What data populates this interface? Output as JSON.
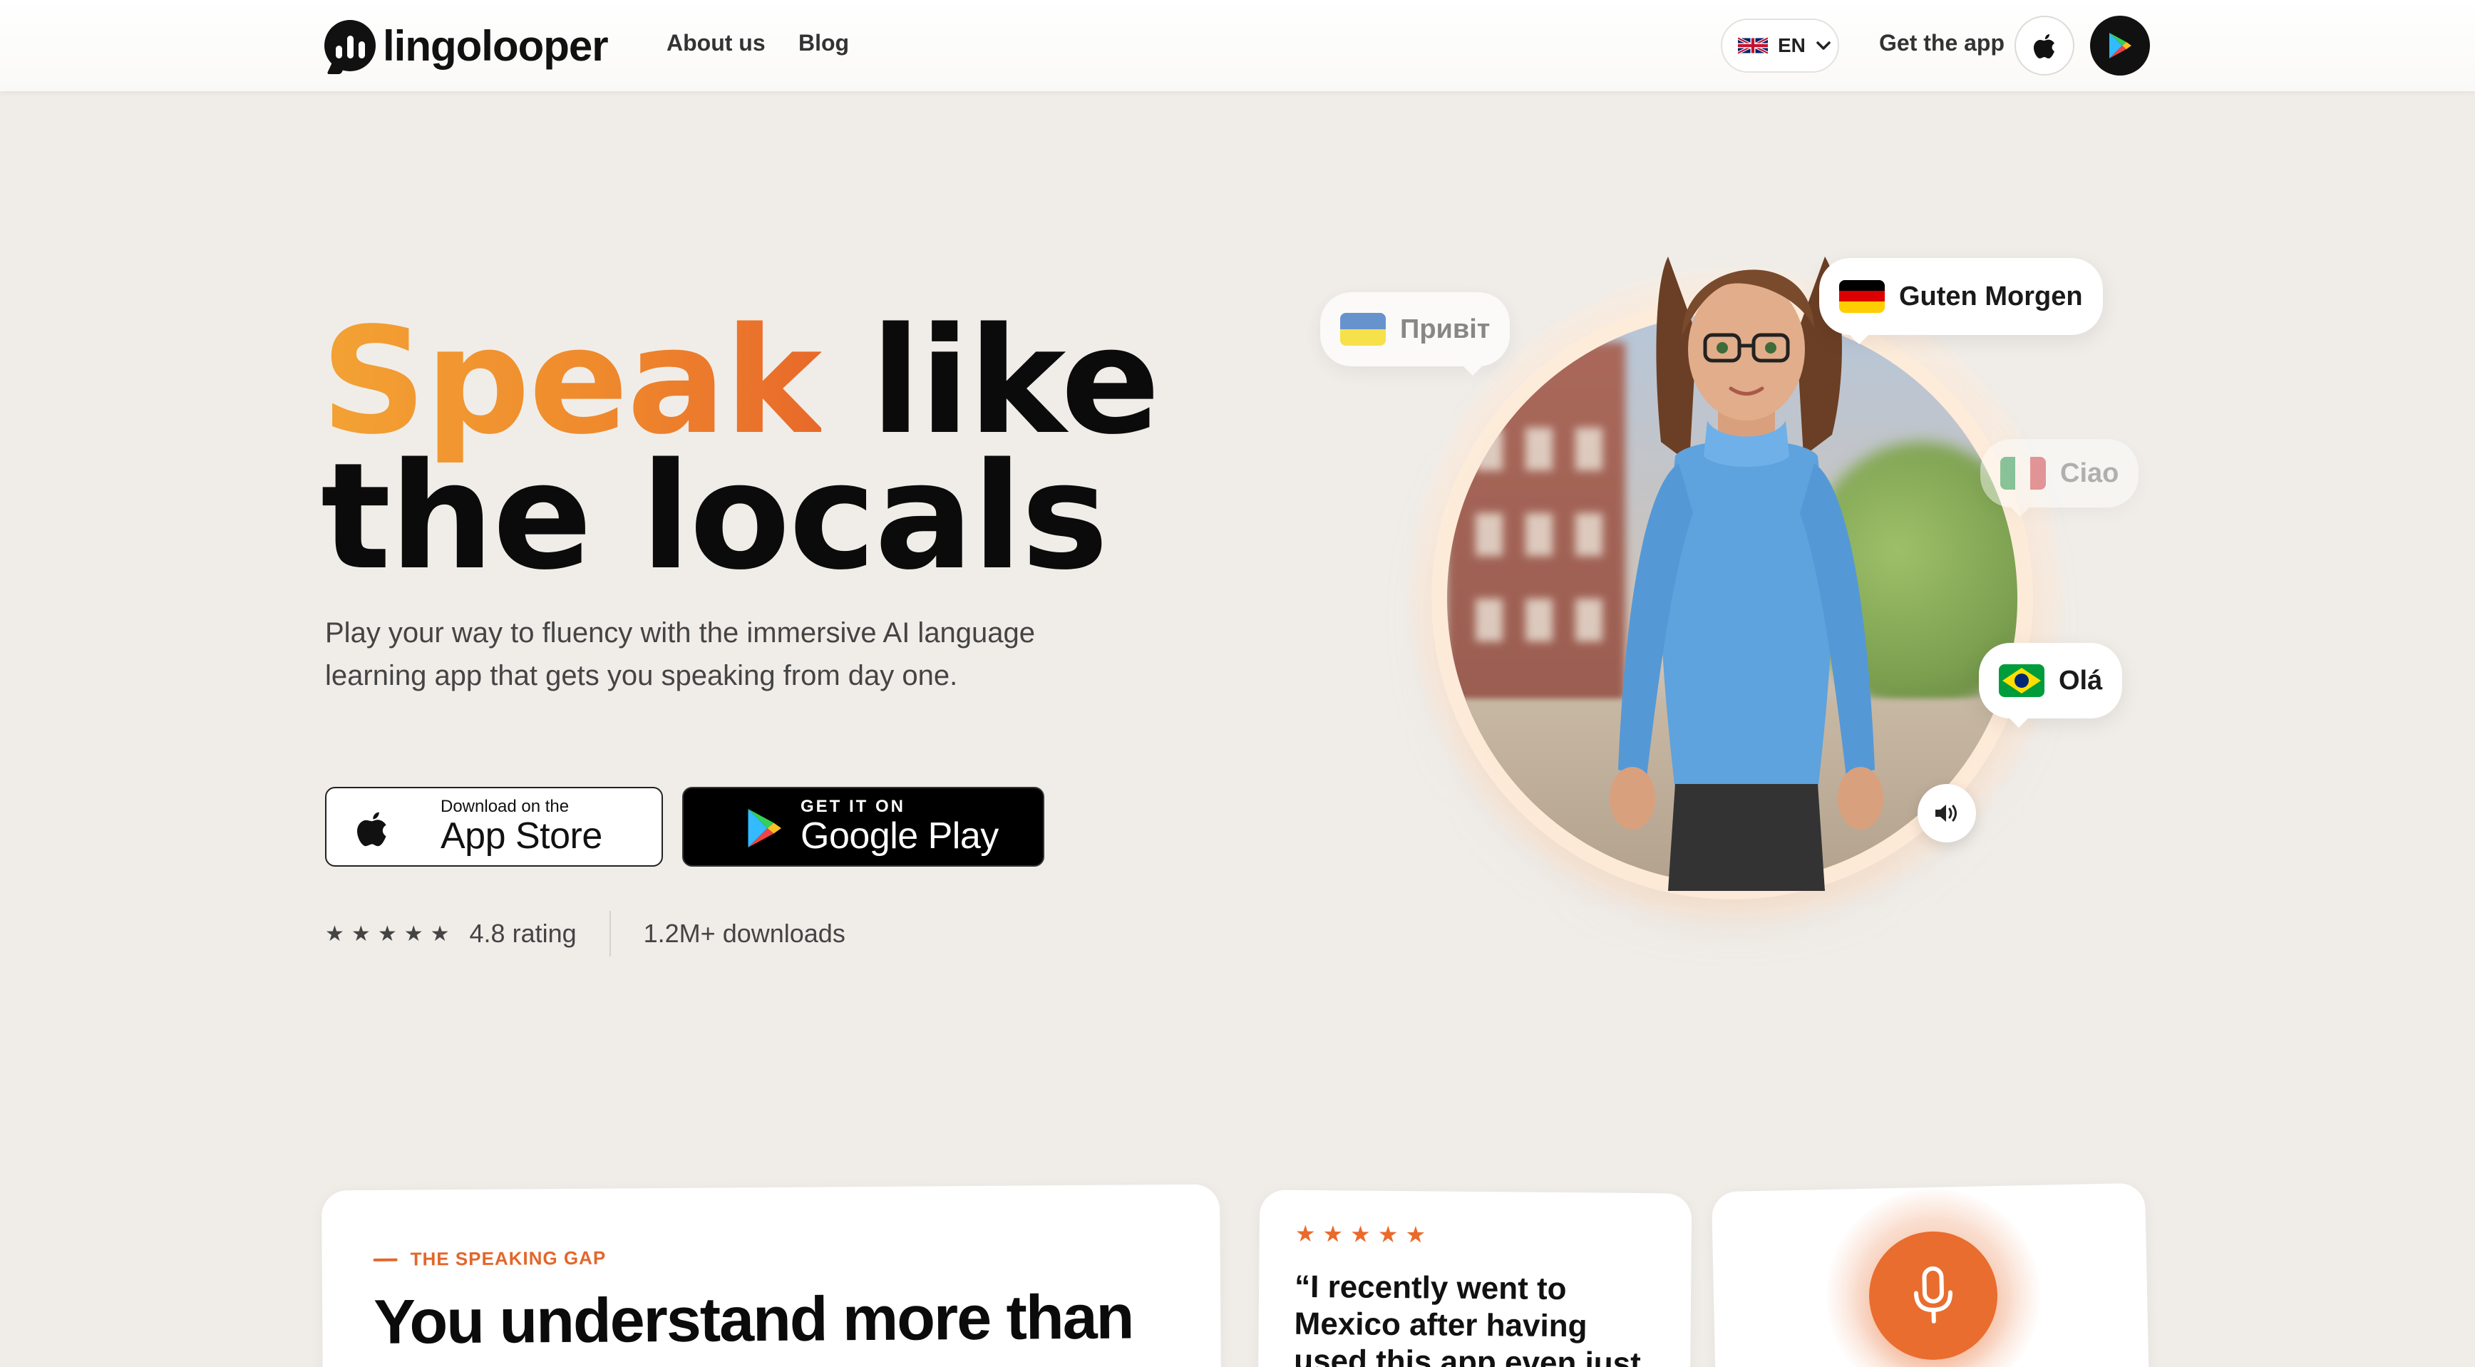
{
  "nav": {
    "brand": "lingolooper",
    "links": [
      "About us",
      "Blog"
    ],
    "language": "EN",
    "get_app": "Get the app"
  },
  "hero": {
    "title_accent": "Speak",
    "title_rest_line1": "like",
    "title_line2": "the locals",
    "subtitle": "Play your way to fluency with the immersive AI language learning app that gets you speaking from day one.",
    "appstore": {
      "small": "Download on the",
      "big": "App Store"
    },
    "googleplay": {
      "small": "GET IT ON",
      "big": "Google Play"
    },
    "rating_stars": 5,
    "rating": "4.8 rating",
    "downloads": "1.2M+ downloads"
  },
  "greetings": [
    {
      "text": "Привіт",
      "flag": "ukraine-flag"
    },
    {
      "text": "Guten Morgen",
      "flag": "germany-flag"
    },
    {
      "text": "Ciao",
      "flag": "italy-flag"
    },
    {
      "text": "Olá",
      "flag": "brazil-flag"
    }
  ],
  "cards": {
    "gap": {
      "eyebrow": "THE SPEAKING GAP",
      "title": "You understand more than"
    },
    "quote": {
      "stars": 5,
      "text": "“I recently went to Mexico after having used this app even just brief"
    }
  },
  "colors": {
    "accent_orange": "#e96d2f",
    "accent_gradient_start": "#f3a234",
    "background": "#f0ede9"
  }
}
